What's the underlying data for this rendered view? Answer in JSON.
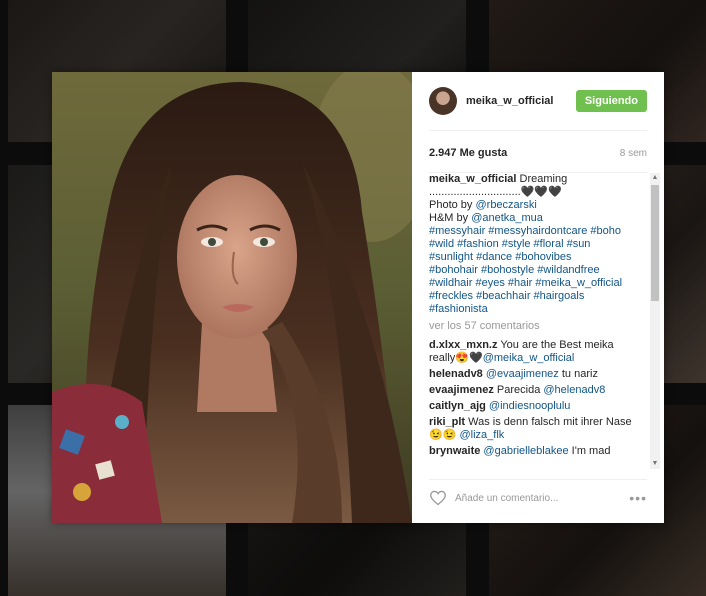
{
  "post": {
    "username": "meika_w_official",
    "follow_label": "Siguiendo",
    "likes": "2.947 Me gusta",
    "time": "8 sem",
    "caption": {
      "user": "meika_w_official",
      "line1": "Dreaming",
      "line2": "..............................🖤🖤🖤",
      "photo_label": "Photo by ",
      "photo_user": "@rbeczarski",
      "hm_label": "H&M by ",
      "hm_user": "@anetka_mua",
      "tags": [
        "#messyhair #messyhairdontcare #boho",
        "#wild #fashion #style #floral #sun",
        "#sunlight #dance #bohovibes",
        "#bohohair #bohostyle #wildandfree",
        "#wildhair #eyes #hair #meika_w_official",
        "#freckles #beachhair #hairgoals",
        "#fashionista"
      ]
    },
    "view_comments": "ver los 57 comentarios",
    "comments": [
      {
        "user": "d.xlxx_mxn.z",
        "text": "You are the Best meika really😍🖤",
        "mention": "@meika_w_official"
      },
      {
        "user": "helenadv8",
        "mention": "@evaajimenez",
        "text": "tu nariz"
      },
      {
        "user": "evaajimenez",
        "text": "Parecida",
        "mention": "@helenadv8"
      },
      {
        "user": "caitlyn_ajg",
        "text": "",
        "mention": "@indiesnooplulu"
      },
      {
        "user": "riki_plt",
        "text": "Was is denn falsch mit ihrer Nase 😉😉",
        "mention": "@liza_flk"
      },
      {
        "user": "brynwaite",
        "mention": "@gabrielleblakee",
        "text": "I'm mad"
      }
    ],
    "add_comment_placeholder": "Añade un comentario...",
    "more_options": "•••"
  },
  "colors": {
    "follow_green": "#70c050",
    "link_blue": "#125688"
  }
}
